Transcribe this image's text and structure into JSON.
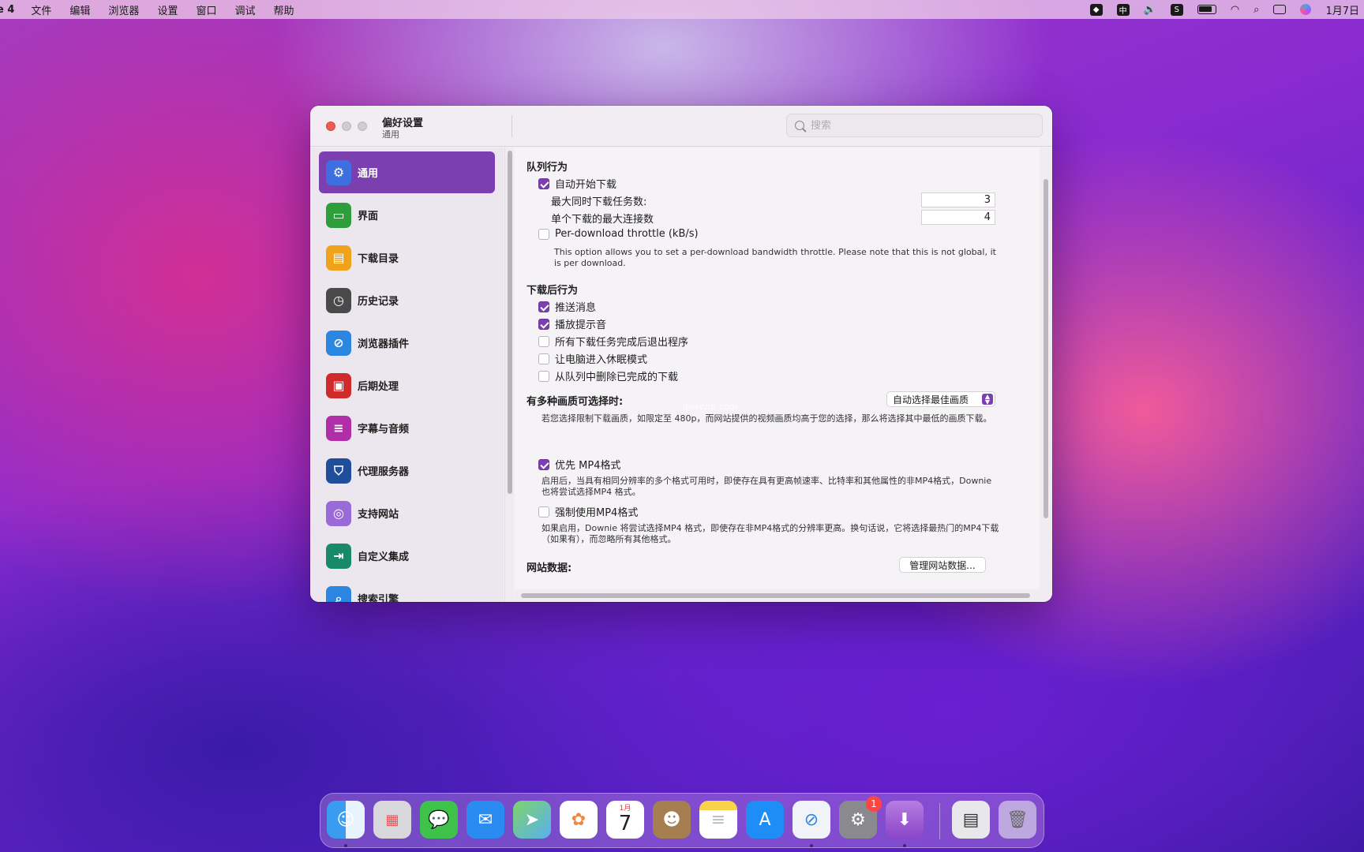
{
  "menubar": {
    "app": "e 4",
    "menus": [
      "文件",
      "编辑",
      "浏览器",
      "设置",
      "窗口",
      "调试",
      "帮助"
    ],
    "ime": "中",
    "clock": "1月7日"
  },
  "window": {
    "title": "偏好设置",
    "subtitle": "通用",
    "search_placeholder": "搜索"
  },
  "sidebar": {
    "items": [
      {
        "label": "通用",
        "icon": "gear-icon",
        "color": "#3d6fe0"
      },
      {
        "label": "界面",
        "icon": "window-icon",
        "color": "#2e9e3a"
      },
      {
        "label": "下载目录",
        "icon": "drive-icon",
        "color": "#f0a21a"
      },
      {
        "label": "历史记录",
        "icon": "clock-icon",
        "color": "#4a4a4a"
      },
      {
        "label": "浏览器插件",
        "icon": "compass-icon",
        "color": "#2a86e0"
      },
      {
        "label": "后期处理",
        "icon": "chip-icon",
        "color": "#d02a2a"
      },
      {
        "label": "字幕与音频",
        "icon": "subtitle-icon",
        "color": "#b02ea8"
      },
      {
        "label": "代理服务器",
        "icon": "shield-icon",
        "color": "#1f4f9a"
      },
      {
        "label": "支持网站",
        "icon": "globe-icon",
        "color": "#9a6ad8"
      },
      {
        "label": "自定义集成",
        "icon": "integration-icon",
        "color": "#188a6a"
      },
      {
        "label": "搜索引擎",
        "icon": "search-icon",
        "color": "#2a86e0"
      }
    ]
  },
  "content": {
    "queue": {
      "heading": "队列行为",
      "auto_start": "自动开始下载",
      "max_downloads_label": "最大同时下载任务数:",
      "max_downloads_value": "3",
      "max_connections_label": "单个下载的最大连接数",
      "max_connections_value": "4",
      "throttle_label": "Per-download throttle (kB/s)",
      "throttle_note": "This option allows you to set a per-download bandwidth throttle. Please note that this is not global, it is per download."
    },
    "after": {
      "heading": "下载后行为",
      "items": [
        "推送消息",
        "播放提示音",
        "所有下载任务完成后退出程序",
        "让电脑进入休眠模式",
        "从队列中删除已完成的下载"
      ]
    },
    "quality": {
      "label": "有多种画质可选择时:",
      "selected": "自动选择最佳画质",
      "note": "若您选择限制下载画质，如限定至 480p，而网站提供的视频画质均高于您的选择，那么将选择其中最低的画质下载。"
    },
    "mp4": {
      "prefer_label": "优先 MP4格式",
      "prefer_note": "启用后，当具有相同分辨率的多个格式可用时，即使存在具有更高帧速率、比特率和其他属性的非MP4格式，Downie  也将尝试选择MP4 格式。",
      "force_label": "强制使用MP4格式",
      "force_note": "如果启用，Downie 将尝试选择MP4 格式，即使存在非MP4格式的分辨率更高。换句话说，它将选择最热门的MP4下载（如果有），而忽略所有其他格式。"
    },
    "site_data": {
      "label": "网站数据:",
      "button": "管理网站数据..."
    }
  },
  "watermark": "iplayzip.com",
  "dock": {
    "calendar_month": "1月",
    "calendar_day": "7",
    "settings_badge": "1"
  }
}
